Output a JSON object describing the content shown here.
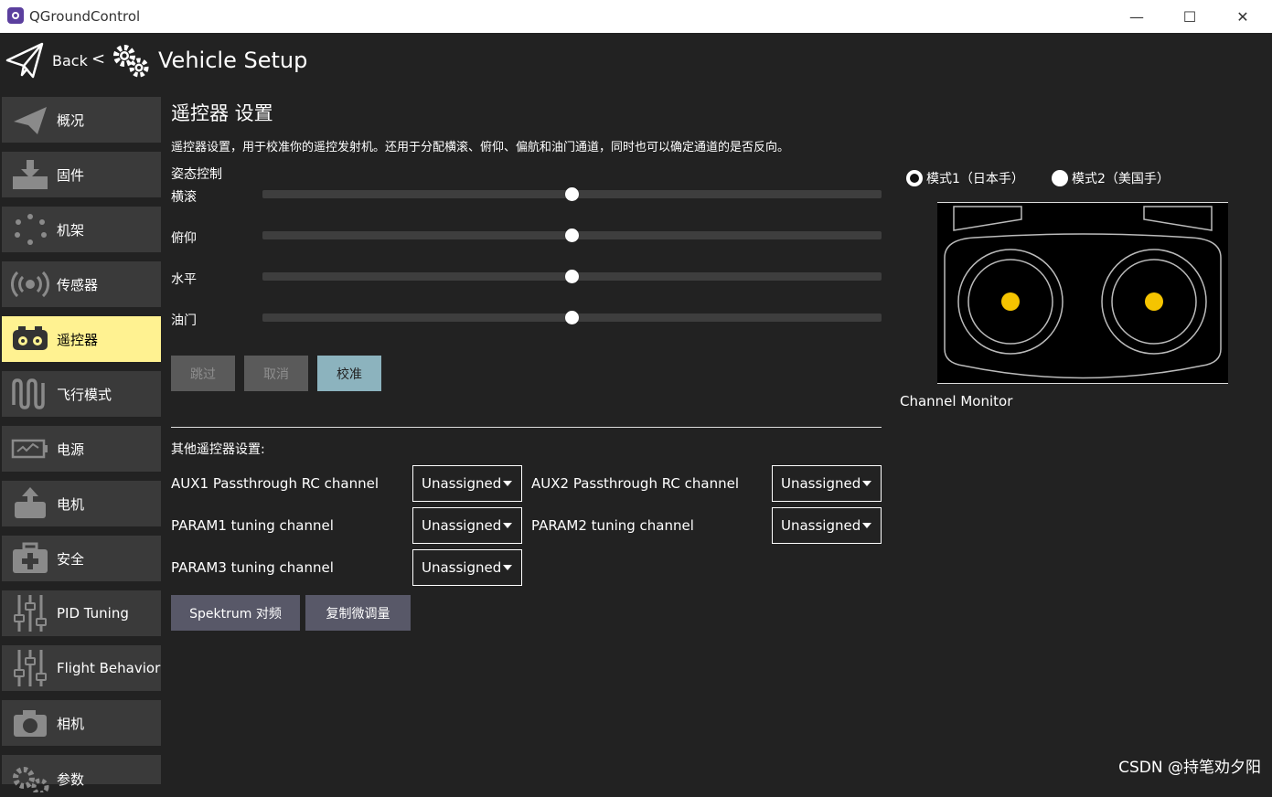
{
  "window": {
    "title": "QGroundControl"
  },
  "toolbar": {
    "back_label": "Back",
    "separator": "<",
    "title": "Vehicle Setup"
  },
  "sidebar": {
    "items": [
      {
        "label": "概况",
        "icon": "paper-plane-icon"
      },
      {
        "label": "固件",
        "icon": "download-icon"
      },
      {
        "label": "机架",
        "icon": "frame-icon"
      },
      {
        "label": "传感器",
        "icon": "sensor-icon"
      },
      {
        "label": "遥控器",
        "icon": "radio-icon",
        "active": true
      },
      {
        "label": "飞行模式",
        "icon": "wave-icon"
      },
      {
        "label": "电源",
        "icon": "battery-icon"
      },
      {
        "label": "电机",
        "icon": "motor-icon"
      },
      {
        "label": "安全",
        "icon": "medkit-icon"
      },
      {
        "label": "PID Tuning",
        "icon": "sliders-icon"
      },
      {
        "label": "Flight Behavior",
        "icon": "sliders-icon"
      },
      {
        "label": "相机",
        "icon": "camera-icon"
      },
      {
        "label": "参数",
        "icon": "gears-icon"
      }
    ]
  },
  "main": {
    "heading": "遥控器 设置",
    "description": "遥控器设置，用于校准你的遥控发射机。还用于分配横滚、俯仰、偏航和油门通道，同时也可以确定通道的是否反向。",
    "attitude_label": "姿态控制",
    "axes": [
      {
        "label": "横滚",
        "value": 0.5
      },
      {
        "label": "俯仰",
        "value": 0.5
      },
      {
        "label": "水平",
        "value": 0.5
      },
      {
        "label": "油门",
        "value": 0.5
      }
    ],
    "buttons": {
      "skip": "跳过",
      "cancel": "取消",
      "calibrate": "校准"
    },
    "other_label": "其他遥控器设置:",
    "channels": [
      {
        "label": "AUX1 Passthrough RC channel",
        "value": "Unassigned"
      },
      {
        "label": "AUX2 Passthrough RC channel",
        "value": "Unassigned"
      },
      {
        "label": "PARAM1 tuning channel",
        "value": "Unassigned"
      },
      {
        "label": "PARAM2 tuning channel",
        "value": "Unassigned"
      },
      {
        "label": "PARAM3 tuning channel",
        "value": "Unassigned"
      }
    ],
    "spektrum_button": "Spektrum 对频",
    "copy_trims_button": "复制微调量"
  },
  "right": {
    "mode1_label": "模式1（日本手）",
    "mode2_label": "模式2（美国手）",
    "selected_mode": 1,
    "monitor_label": "Channel Monitor",
    "stick_color": "#f5c400"
  },
  "watermark": "CSDN @持笔劝夕阳",
  "colors": {
    "active_item": "#fff291",
    "calibrate_button": "#8cb3be",
    "sidebar_item": "#3a3a3a"
  }
}
